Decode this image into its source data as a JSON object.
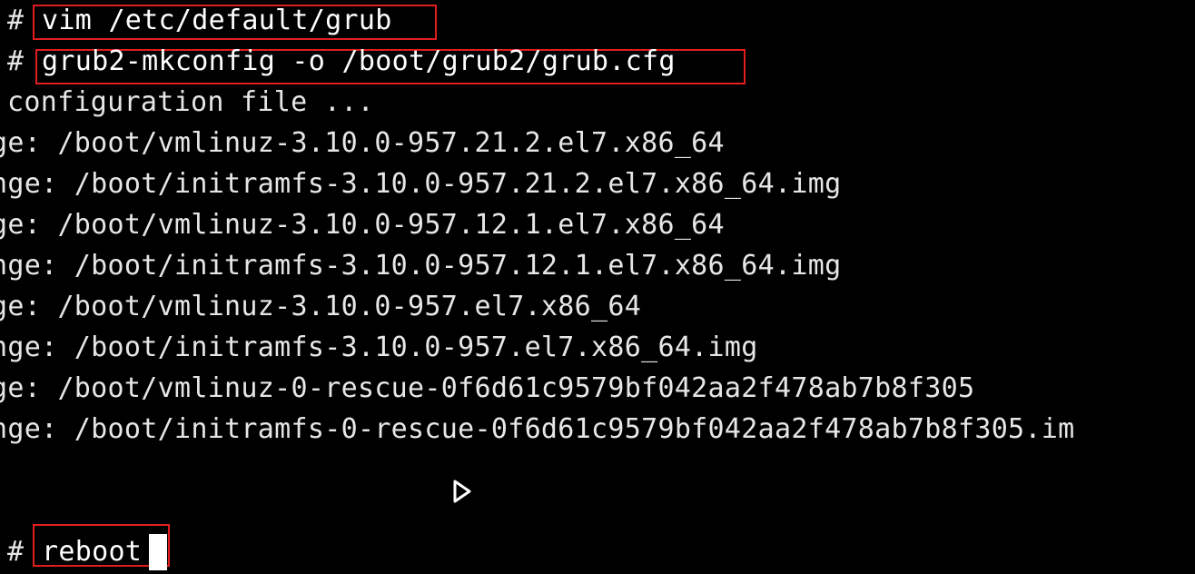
{
  "terminal": {
    "prompt_symbol": "#",
    "commands": {
      "edit_grub": "vim /etc/default/grub",
      "mkconfig": "grub2-mkconfig -o /boot/grub2/grub.cfg",
      "reboot": "reboot"
    },
    "output_lines": [
      "configuration file ...",
      "ge: /boot/vmlinuz-3.10.0-957.21.2.el7.x86_64",
      "nge: /boot/initramfs-3.10.0-957.21.2.el7.x86_64.img",
      "ge: /boot/vmlinuz-3.10.0-957.12.1.el7.x86_64",
      "nge: /boot/initramfs-3.10.0-957.12.1.el7.x86_64.img",
      "ge: /boot/vmlinuz-3.10.0-957.el7.x86_64",
      "nge: /boot/initramfs-3.10.0-957.el7.x86_64.img",
      "ge: /boot/vmlinuz-0-rescue-0f6d61c9579bf042aa2f478ab7b8f305",
      "nge: /boot/initramfs-0-rescue-0f6d61c9579bf042aa2f478ab7b8f305.im"
    ],
    "icons": {
      "mouse_pointer": "play-cursor-icon"
    },
    "colors": {
      "background": "#000000",
      "text": "#e6e6e6",
      "highlight_border": "#e01e1e"
    }
  }
}
